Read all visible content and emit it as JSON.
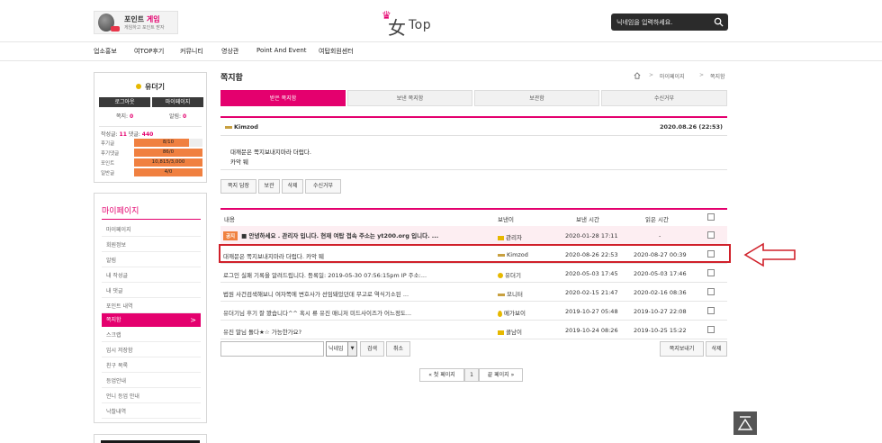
{
  "header": {
    "promo_title": "포인트",
    "promo_title_accent": "게임",
    "promo_subtitle": "게임하고 포인트 받자",
    "logo_crown": "♛",
    "logo_hanja": "女",
    "logo_text": "Top",
    "search_placeholder": "닉네임을 입력하세요."
  },
  "nav": {
    "items": [
      "업소홍보",
      "여TOP후기",
      "커뮤니티",
      "영상관",
      "Point And Event",
      "여탑회원센터"
    ]
  },
  "profile": {
    "nickname": "유더기",
    "logout_label": "로그아웃",
    "mypage_label": "마이페이지",
    "message_label": "쪽지:",
    "message_count": "0",
    "alarm_label": "알림:",
    "alarm_count": "0",
    "posts_label": "작성글:",
    "posts_count": "11",
    "comments_label": "댓글:",
    "comments_count": "440",
    "levels": [
      {
        "label": "후기글",
        "value": "8/10",
        "fill": 0.8
      },
      {
        "label": "후기댓글",
        "value": "86/0",
        "fill": 1.0
      },
      {
        "label": "포인트",
        "value": "10,815/3,000",
        "fill": 1.0
      },
      {
        "label": "일반글",
        "value": "4/0",
        "fill": 1.0
      }
    ]
  },
  "mypage_menu": {
    "title": "마이페이지",
    "items": [
      "마이페이지",
      "회원정보",
      "알림",
      "내 작성글",
      "내 댓글",
      "포인트 내역",
      "쪽지함",
      "스크랩",
      "임시 저장함",
      "친구 목록",
      "등업안내",
      "언니 등업 안내",
      "낙찰내역"
    ],
    "active_index": 6,
    "chevron": ">"
  },
  "page": {
    "title": "쪽지함",
    "breadcrumb": [
      "마이페이지",
      "쪽지함"
    ],
    "breadcrumb_sep": ">"
  },
  "tabs": [
    "받은 쪽지함",
    "보낸 쪽지함",
    "보관함",
    "수신거부"
  ],
  "message_view": {
    "sender": "Kimzod",
    "date": "2020.08.26 (22:53)",
    "body_line1": "대깨문은 쪽지보내지마라 더럽다.",
    "body_line2": "카악 퉤"
  },
  "view_actions": [
    "쪽지 답장",
    "보관",
    "삭제",
    "수신거부"
  ],
  "list": {
    "headers": {
      "content": "내용",
      "sender": "보낸이",
      "sent": "보낸 시간",
      "read": "읽은 시간"
    },
    "notice_badge": "공지",
    "rows": [
      {
        "content": "■ 안녕하세요 . 관리자 입니다. 현재 여탑 접속 주소는 yt200.org 입니다. ...",
        "sender": "관리자",
        "sent": "2020-01-28 17:11",
        "read": "-",
        "notice": true,
        "icon": "box"
      },
      {
        "content": "대깨문은 쪽지보내지마라 더럽다. 카악 퉤",
        "sender": "Kimzod",
        "sent": "2020-08-26 22:53",
        "read": "2020-08-27 00:39",
        "notice": false,
        "icon": "bar"
      },
      {
        "content": "로그인 실패 기록을 알려드립니다. 등록일: 2019-05-30 07:56:15pm IP 주소:...",
        "sender": "유더기",
        "sent": "2020-05-03 17:45",
        "read": "2020-05-03 17:46",
        "notice": false,
        "icon": "coin"
      },
      {
        "content": "법원 사건검색해보니 여자쪽에 변호사가 선임돼있던데 무고로 역식기소된 ...",
        "sender": "모니터",
        "sent": "2020-02-15 21:47",
        "read": "2020-02-16 08:36",
        "notice": false,
        "icon": "bar"
      },
      {
        "content": "유더기님 후기 잘 봤습니다^^ 혹시 류 유진 매니저 미드사이즈가 어느정도...",
        "sender": "메가보이",
        "sent": "2019-10-27 05:48",
        "read": "2019-10-27 22:08",
        "notice": false,
        "icon": "drop"
      },
      {
        "content": "유진 말님 돌다★☆ 가능한가요?",
        "sender": "콜남이",
        "sent": "2019-10-24 08:26",
        "read": "2019-10-25 15:22",
        "notice": false,
        "icon": "box"
      }
    ]
  },
  "bottom_bar": {
    "select_value": "닉네임",
    "search_button": "검색",
    "cancel_button": "취소",
    "send_button": "쪽지보내기",
    "delete_button": "삭제"
  },
  "pager": {
    "first": "« 첫 페이지",
    "current": "1",
    "last": "끝 페이지 »"
  },
  "colors": {
    "accent": "#e4006e",
    "highlight": "#d0202a",
    "bar_fill": "#f08040"
  }
}
